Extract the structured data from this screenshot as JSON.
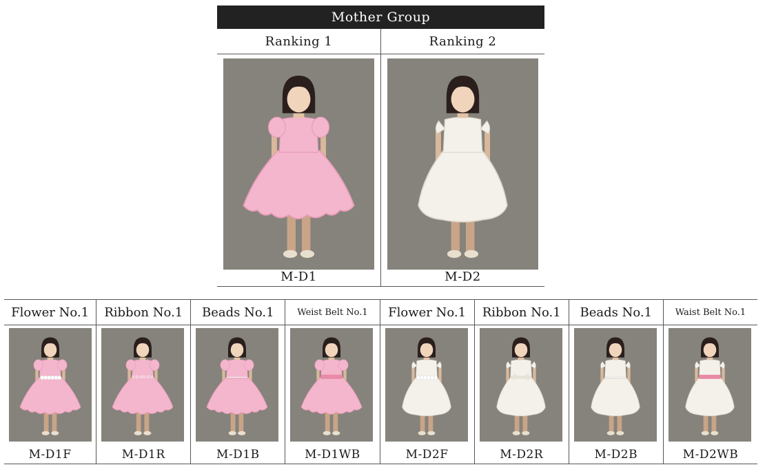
{
  "header": {
    "title": "Mother Group"
  },
  "rankings": [
    {
      "label": "Ranking 1",
      "code": "M-D1",
      "dress": "pink",
      "photo_icon": "pink-dress-girl-photo"
    },
    {
      "label": "Ranking 2",
      "code": "M-D2",
      "dress": "white",
      "photo_icon": "white-dress-girl-photo"
    }
  ],
  "variants": [
    {
      "label": "Flower No.1",
      "code": "M-D1F",
      "dress": "pink",
      "detail": "flower"
    },
    {
      "label": "Ribbon No.1",
      "code": "M-D1R",
      "dress": "pink",
      "detail": "ribbon"
    },
    {
      "label": "Beads No.1",
      "code": "M-D1B",
      "dress": "pink",
      "detail": "beads"
    },
    {
      "label": "Weist Belt No.1",
      "code": "M-D1WB",
      "dress": "pink",
      "detail": "belt"
    },
    {
      "label": "Flower No.1",
      "code": "M-D2F",
      "dress": "white",
      "detail": "flower"
    },
    {
      "label": "Ribbon No.1",
      "code": "M-D2R",
      "dress": "white",
      "detail": "ribbon"
    },
    {
      "label": "Beads No.1",
      "code": "M-D2B",
      "dress": "white",
      "detail": "beads"
    },
    {
      "label": "Waist Belt No.1",
      "code": "M-D2WB",
      "dress": "white",
      "detail": "belt"
    }
  ],
  "colors": {
    "header_bg": "#222222",
    "photo_bg": "#85837c",
    "pink_dress": "#f3b6cc",
    "white_dress": "#f4f1ea",
    "belt_pink": "#e98aa8"
  }
}
